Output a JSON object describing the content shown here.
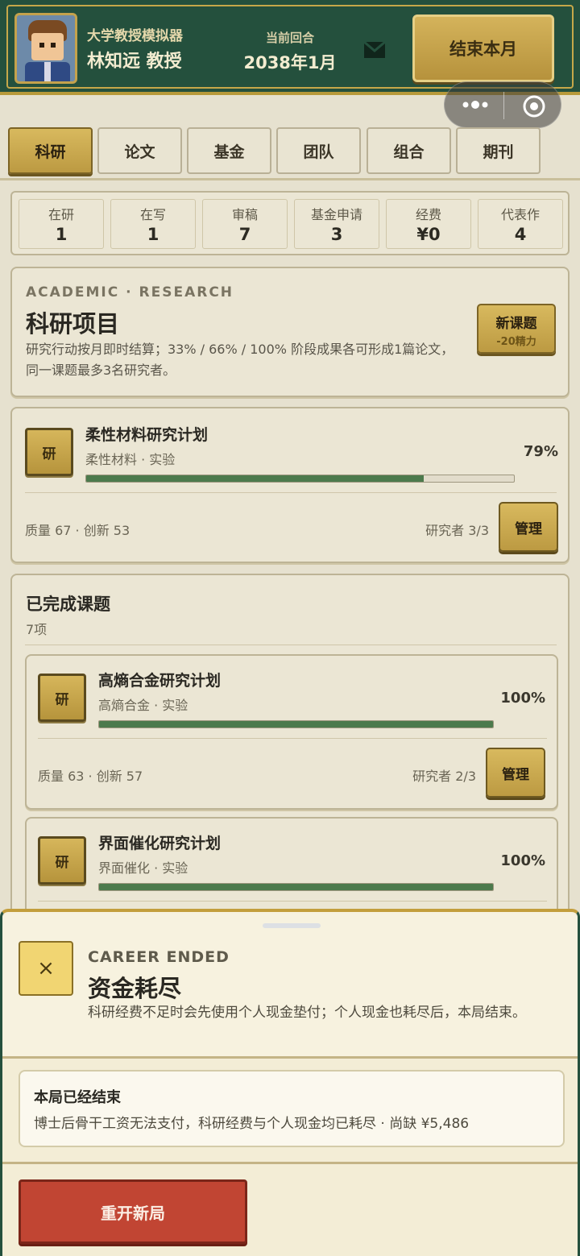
{
  "header": {
    "game_name": "大学教授模拟器",
    "player_name": "林知远 教授",
    "round_label": "当前回合",
    "round_value": "2038年1月",
    "end_month_label": "结束本月"
  },
  "tabs": [
    "科研",
    "论文",
    "基金",
    "团队",
    "组合",
    "期刊"
  ],
  "active_tab": "科研",
  "stats": [
    {
      "label": "在研",
      "value": "1"
    },
    {
      "label": "在写",
      "value": "1"
    },
    {
      "label": "审稿",
      "value": "7"
    },
    {
      "label": "基金申请",
      "value": "3"
    },
    {
      "label": "经费",
      "value": "¥0"
    },
    {
      "label": "代表作",
      "value": "4"
    }
  ],
  "research": {
    "eyebrow": "ACADEMIC · RESEARCH",
    "title": "科研项目",
    "description": "研究行动按月即时结算；33% / 66% / 100% 阶段成果各可形成1篇论文，同一课题最多3名研究者。",
    "new_topic_label": "新课题",
    "new_topic_cost": "-20精力"
  },
  "active_project": {
    "badge": "研",
    "title": "柔性材料研究计划",
    "subtitle": "柔性材料 · 实验",
    "percent_label": "79%",
    "progress": 0.79,
    "meta": "质量 67 · 创新 53",
    "researchers": "研究者 3/3",
    "manage_label": "管理"
  },
  "completed": {
    "title": "已完成课题",
    "count": "7项",
    "projects": [
      {
        "badge": "研",
        "title": "高熵合金研究计划",
        "subtitle": "高熵合金 · 实验",
        "percent_label": "100%",
        "progress": 1.0,
        "meta": "质量 63 · 创新 57",
        "researchers": "研究者 2/3",
        "manage_label": "管理"
      },
      {
        "badge": "研",
        "title": "界面催化研究计划",
        "subtitle": "界面催化 · 实验",
        "percent_label": "100%",
        "progress": 1.0
      }
    ]
  },
  "modal": {
    "close_symbol": "×",
    "eyebrow": "CAREER ENDED",
    "title": "资金耗尽",
    "description": "科研经费不足时会先使用个人现金垫付；个人现金也耗尽后，本局结束。",
    "notice_title": "本局已经结束",
    "notice_text": "博士后骨干工资无法支付，科研经费与个人现金均已耗尽 · 尚缺 ¥5,486",
    "restart_label": "重开新局"
  },
  "colors": {
    "header_green": "#24503d",
    "gold": "#c6a749",
    "progress_green": "#4c7a4c",
    "danger_red": "#c14533"
  },
  "icons": [
    "mail-icon",
    "more-icon",
    "target-icon",
    "close-icon"
  ]
}
